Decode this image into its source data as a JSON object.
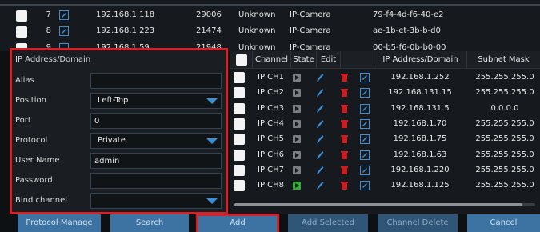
{
  "device_list": {
    "rows": [
      {
        "index": "7",
        "ip": "192.168.1.118",
        "port": "29006",
        "model": "Unknown",
        "type": "IP-Camera",
        "mac": "79-f4-4d-f6-40-e2"
      },
      {
        "index": "8",
        "ip": "192.168.1.223",
        "port": "21474",
        "model": "Unknown",
        "type": "IP-Camera",
        "mac": "ae-1b-et-3b-b-d0"
      },
      {
        "index": "9",
        "ip": "192.168.1.59",
        "port": "21948",
        "model": "Unknown",
        "type": "IP-Camera",
        "mac": "00-b5-f6-0b-b0-00"
      }
    ]
  },
  "form": {
    "ip_label": "IP Address/Domain",
    "alias_label": "Alias",
    "alias_value": "",
    "position_label": "Position",
    "position_value": "Left-Top",
    "port_label": "Port",
    "port_value": "0",
    "protocol_label": "Protocol",
    "protocol_value": "Private",
    "username_label": "User Name",
    "username_value": "admin",
    "password_label": "Password",
    "password_value": "",
    "bind_label": "Bind channel",
    "bind_value": ""
  },
  "channel_table": {
    "headers": {
      "channel": "Channel",
      "state": "State",
      "edit": "Edit",
      "ip": "IP Address/Domain",
      "mask": "Subnet Mask"
    },
    "rows": [
      {
        "channel": "IP CH1",
        "ip": "192.168.1.252",
        "mask": "255.255.255.0",
        "online": false
      },
      {
        "channel": "IP CH2",
        "ip": "192.168.131.15",
        "mask": "255.255.255.0",
        "online": false
      },
      {
        "channel": "IP CH3",
        "ip": "192.168.131.5",
        "mask": "0.0.0.0",
        "online": false
      },
      {
        "channel": "IP CH4",
        "ip": "192.168.1.70",
        "mask": "255.255.255.0",
        "online": false
      },
      {
        "channel": "IP CH5",
        "ip": "192.168.1.75",
        "mask": "255.255.255.0",
        "online": false
      },
      {
        "channel": "IP CH6",
        "ip": "192.168.1.63",
        "mask": "255.255.255.0",
        "online": false
      },
      {
        "channel": "IP CH7",
        "ip": "192.168.1.220",
        "mask": "255.255.255.0",
        "online": false
      },
      {
        "channel": "IP CH8",
        "ip": "192.168.1.125",
        "mask": "255.255.255.0",
        "online": true
      }
    ]
  },
  "buttons": {
    "protocol_manage": "Protocol Manage",
    "search": "Search",
    "add": "Add",
    "add_selected": "Add Selected",
    "channel_delete": "Channel Delete",
    "cancel": "Cancel"
  },
  "colors": {
    "highlight": "#d2222a",
    "accent": "#3b8fd6",
    "online": "#2fb03a"
  }
}
